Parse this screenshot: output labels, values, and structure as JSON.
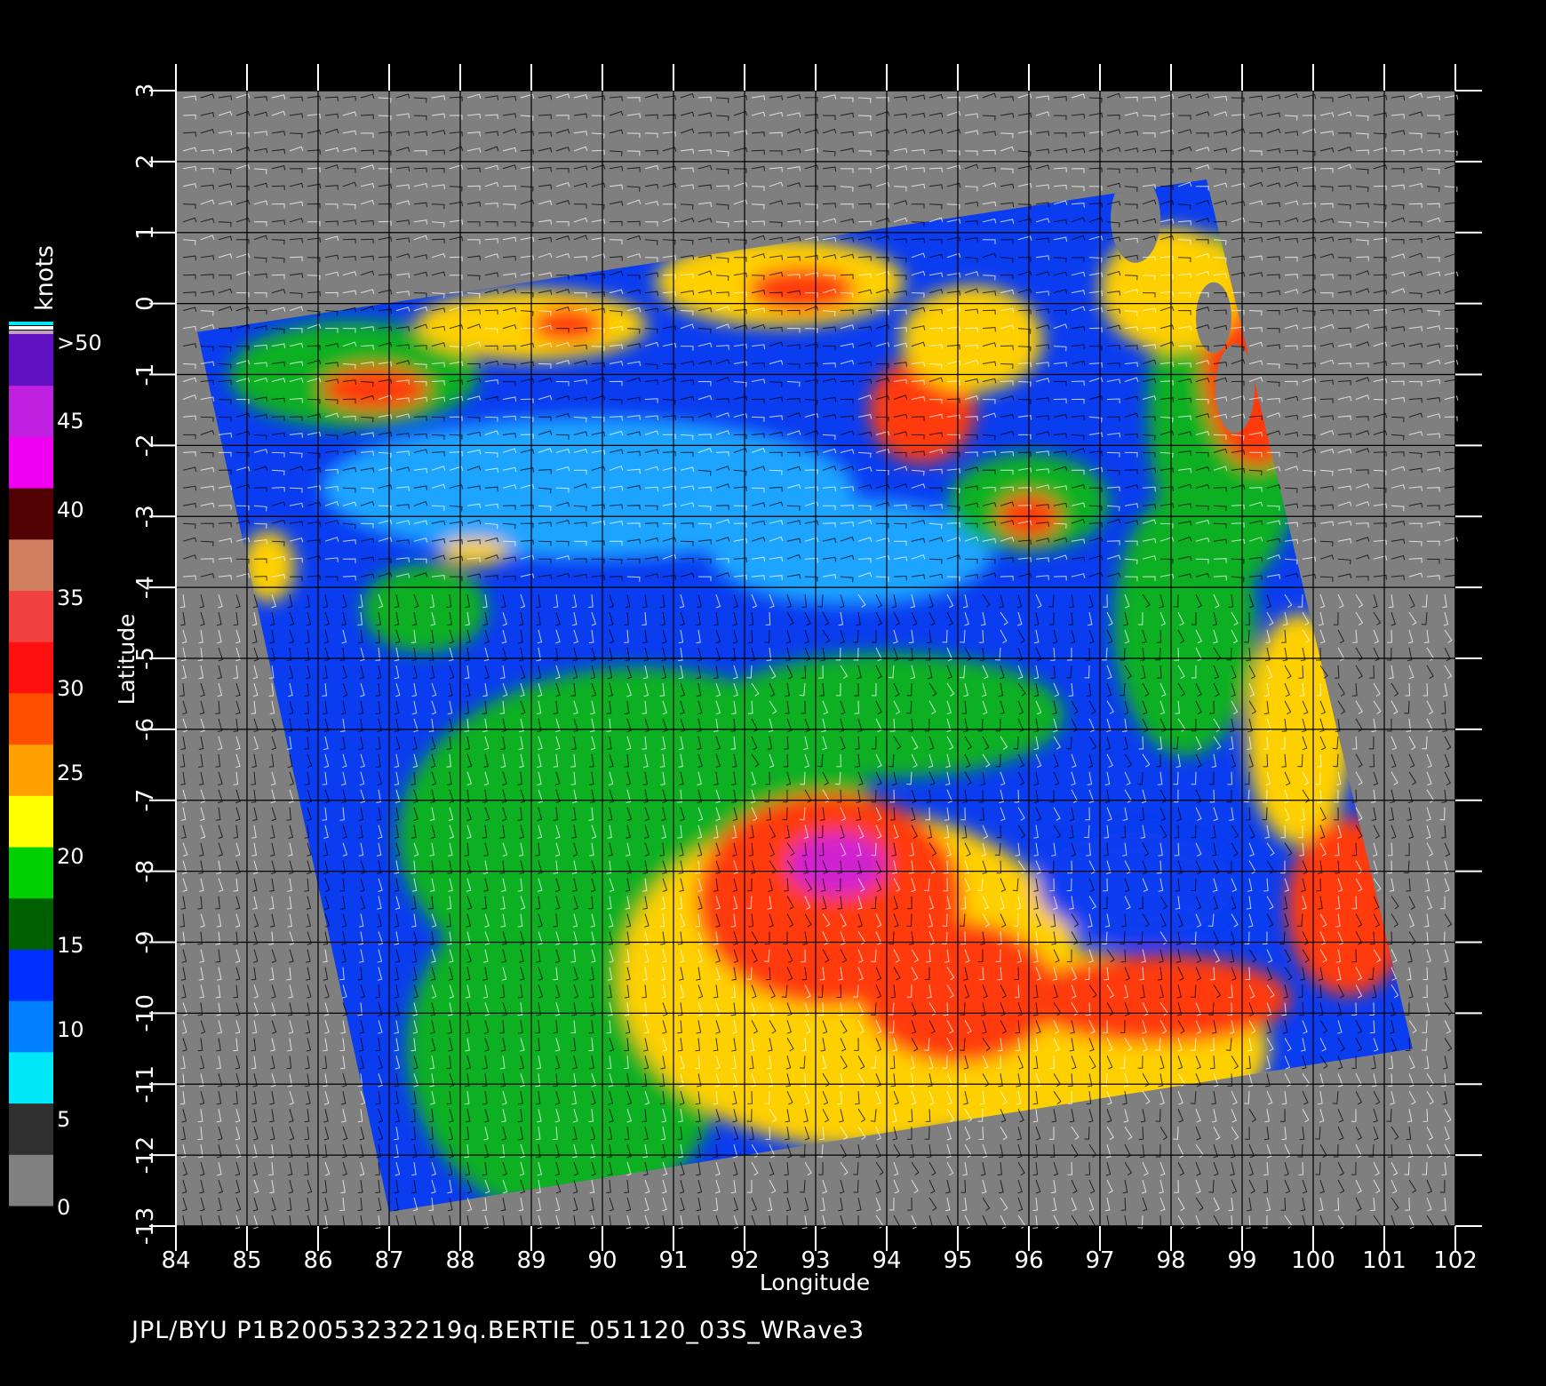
{
  "title_line": "JPL/BYU  P1B20053232219q.BERTIE_051120_03S_WRave3",
  "axes": {
    "xlabel": "Longitude",
    "ylabel": "Latitude",
    "xticks": [
      "84",
      "85",
      "86",
      "87",
      "88",
      "89",
      "90",
      "91",
      "92",
      "93",
      "94",
      "95",
      "96",
      "97",
      "98",
      "99",
      "100",
      "101",
      "102"
    ],
    "yticks": [
      "3",
      "2",
      "1",
      "0",
      "-1",
      "-2",
      "-3",
      "-4",
      "-5",
      "-6",
      "-7",
      "-8",
      "-9",
      "-10",
      "-11",
      "-12",
      "-13"
    ],
    "xlim": [
      84,
      102
    ],
    "ylim": [
      -13,
      3
    ]
  },
  "colorbar": {
    "unit": "knots",
    "labels": [
      ">50",
      "45",
      "40",
      "35",
      "30",
      "25",
      "20",
      "15",
      "10",
      "5",
      "0"
    ],
    "stops": [
      {
        "color": "#808080"
      },
      {
        "color": "#303030"
      },
      {
        "color": "#00e8f8"
      },
      {
        "color": "#0080ff"
      },
      {
        "color": "#0030ff"
      },
      {
        "color": "#006000"
      },
      {
        "color": "#00d000"
      },
      {
        "color": "#ffff00"
      },
      {
        "color": "#ffa000"
      },
      {
        "color": "#ff5000"
      },
      {
        "color": "#ff1010"
      },
      {
        "color": "#f04040"
      },
      {
        "color": "#d08060"
      },
      {
        "color": "#500000"
      },
      {
        "color": "#f000f0"
      },
      {
        "color": "#c020e0"
      },
      {
        "color": "#6010c0"
      }
    ]
  },
  "swath_colors": {
    "no_data": "#7f7f7f",
    "low": "#0a3cf0",
    "light": "#1aa4ff",
    "mid": "#10b020",
    "high": "#ffd000",
    "storm": "#ff3a10",
    "peak": "#d020d0"
  }
}
